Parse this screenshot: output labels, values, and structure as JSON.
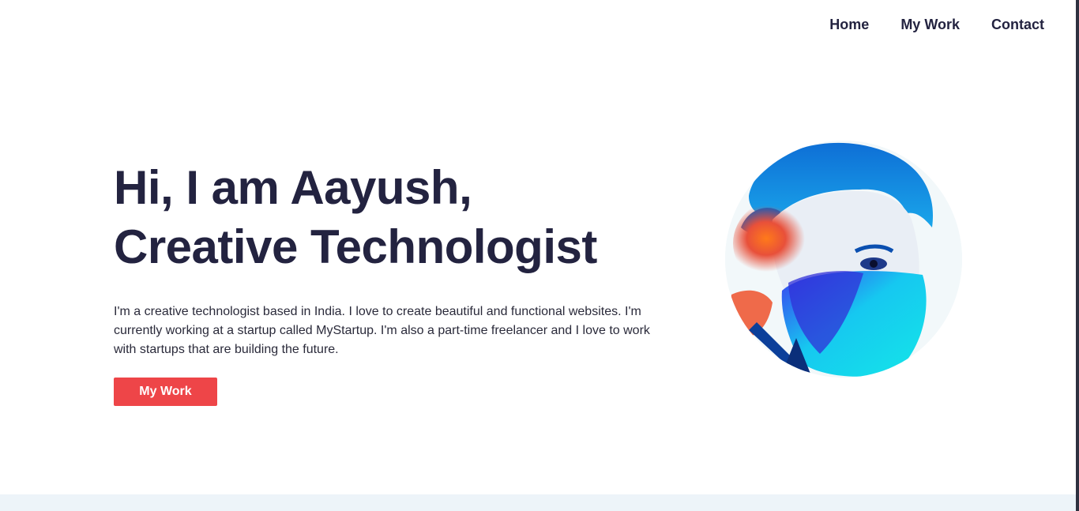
{
  "nav": {
    "items": [
      {
        "label": "Home"
      },
      {
        "label": "My Work"
      },
      {
        "label": "Contact"
      }
    ]
  },
  "hero": {
    "headline_line1": "Hi, I am Aayush,",
    "headline_line2": "Creative Technologist",
    "bio": "I'm a creative technologist based in India. I love to create beautiful and functional websites. I'm currently working at a startup called MyStartup. I'm also a part-time freelancer and I love to work with startups that are building the future.",
    "cta_label": "My Work"
  },
  "colors": {
    "text": "#232340",
    "accent": "#ee4548",
    "band": "#edf4f9"
  }
}
